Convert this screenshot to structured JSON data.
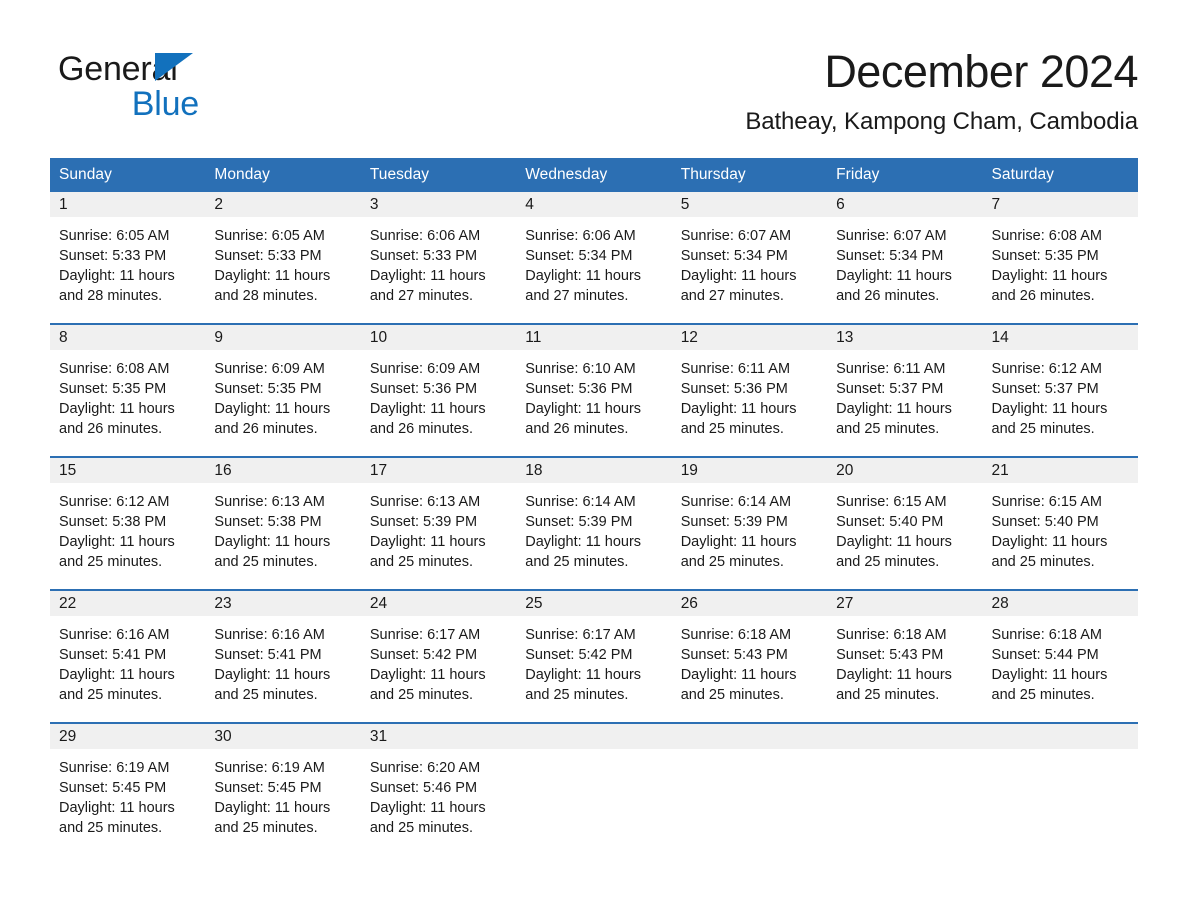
{
  "logo": {
    "word1": "General",
    "word2": "Blue",
    "triangle_color": "#1271BD",
    "word2_color": "#1271BD"
  },
  "header": {
    "month_title": "December 2024",
    "location": "Batheay, Kampong Cham, Cambodia"
  },
  "theme": {
    "header_blue": "#2C6FB3",
    "daynum_band": "#F0F0F0",
    "text": "#1a1a1a",
    "page_background": "#ffffff"
  },
  "weekday_headers": [
    "Sunday",
    "Monday",
    "Tuesday",
    "Wednesday",
    "Thursday",
    "Friday",
    "Saturday"
  ],
  "weeks": [
    [
      {
        "day": "1",
        "sunrise": "Sunrise: 6:05 AM",
        "sunset": "Sunset: 5:33 PM",
        "daylight_line1": "Daylight: 11 hours",
        "daylight_line2": "and 28 minutes."
      },
      {
        "day": "2",
        "sunrise": "Sunrise: 6:05 AM",
        "sunset": "Sunset: 5:33 PM",
        "daylight_line1": "Daylight: 11 hours",
        "daylight_line2": "and 28 minutes."
      },
      {
        "day": "3",
        "sunrise": "Sunrise: 6:06 AM",
        "sunset": "Sunset: 5:33 PM",
        "daylight_line1": "Daylight: 11 hours",
        "daylight_line2": "and 27 minutes."
      },
      {
        "day": "4",
        "sunrise": "Sunrise: 6:06 AM",
        "sunset": "Sunset: 5:34 PM",
        "daylight_line1": "Daylight: 11 hours",
        "daylight_line2": "and 27 minutes."
      },
      {
        "day": "5",
        "sunrise": "Sunrise: 6:07 AM",
        "sunset": "Sunset: 5:34 PM",
        "daylight_line1": "Daylight: 11 hours",
        "daylight_line2": "and 27 minutes."
      },
      {
        "day": "6",
        "sunrise": "Sunrise: 6:07 AM",
        "sunset": "Sunset: 5:34 PM",
        "daylight_line1": "Daylight: 11 hours",
        "daylight_line2": "and 26 minutes."
      },
      {
        "day": "7",
        "sunrise": "Sunrise: 6:08 AM",
        "sunset": "Sunset: 5:35 PM",
        "daylight_line1": "Daylight: 11 hours",
        "daylight_line2": "and 26 minutes."
      }
    ],
    [
      {
        "day": "8",
        "sunrise": "Sunrise: 6:08 AM",
        "sunset": "Sunset: 5:35 PM",
        "daylight_line1": "Daylight: 11 hours",
        "daylight_line2": "and 26 minutes."
      },
      {
        "day": "9",
        "sunrise": "Sunrise: 6:09 AM",
        "sunset": "Sunset: 5:35 PM",
        "daylight_line1": "Daylight: 11 hours",
        "daylight_line2": "and 26 minutes."
      },
      {
        "day": "10",
        "sunrise": "Sunrise: 6:09 AM",
        "sunset": "Sunset: 5:36 PM",
        "daylight_line1": "Daylight: 11 hours",
        "daylight_line2": "and 26 minutes."
      },
      {
        "day": "11",
        "sunrise": "Sunrise: 6:10 AM",
        "sunset": "Sunset: 5:36 PM",
        "daylight_line1": "Daylight: 11 hours",
        "daylight_line2": "and 26 minutes."
      },
      {
        "day": "12",
        "sunrise": "Sunrise: 6:11 AM",
        "sunset": "Sunset: 5:36 PM",
        "daylight_line1": "Daylight: 11 hours",
        "daylight_line2": "and 25 minutes."
      },
      {
        "day": "13",
        "sunrise": "Sunrise: 6:11 AM",
        "sunset": "Sunset: 5:37 PM",
        "daylight_line1": "Daylight: 11 hours",
        "daylight_line2": "and 25 minutes."
      },
      {
        "day": "14",
        "sunrise": "Sunrise: 6:12 AM",
        "sunset": "Sunset: 5:37 PM",
        "daylight_line1": "Daylight: 11 hours",
        "daylight_line2": "and 25 minutes."
      }
    ],
    [
      {
        "day": "15",
        "sunrise": "Sunrise: 6:12 AM",
        "sunset": "Sunset: 5:38 PM",
        "daylight_line1": "Daylight: 11 hours",
        "daylight_line2": "and 25 minutes."
      },
      {
        "day": "16",
        "sunrise": "Sunrise: 6:13 AM",
        "sunset": "Sunset: 5:38 PM",
        "daylight_line1": "Daylight: 11 hours",
        "daylight_line2": "and 25 minutes."
      },
      {
        "day": "17",
        "sunrise": "Sunrise: 6:13 AM",
        "sunset": "Sunset: 5:39 PM",
        "daylight_line1": "Daylight: 11 hours",
        "daylight_line2": "and 25 minutes."
      },
      {
        "day": "18",
        "sunrise": "Sunrise: 6:14 AM",
        "sunset": "Sunset: 5:39 PM",
        "daylight_line1": "Daylight: 11 hours",
        "daylight_line2": "and 25 minutes."
      },
      {
        "day": "19",
        "sunrise": "Sunrise: 6:14 AM",
        "sunset": "Sunset: 5:39 PM",
        "daylight_line1": "Daylight: 11 hours",
        "daylight_line2": "and 25 minutes."
      },
      {
        "day": "20",
        "sunrise": "Sunrise: 6:15 AM",
        "sunset": "Sunset: 5:40 PM",
        "daylight_line1": "Daylight: 11 hours",
        "daylight_line2": "and 25 minutes."
      },
      {
        "day": "21",
        "sunrise": "Sunrise: 6:15 AM",
        "sunset": "Sunset: 5:40 PM",
        "daylight_line1": "Daylight: 11 hours",
        "daylight_line2": "and 25 minutes."
      }
    ],
    [
      {
        "day": "22",
        "sunrise": "Sunrise: 6:16 AM",
        "sunset": "Sunset: 5:41 PM",
        "daylight_line1": "Daylight: 11 hours",
        "daylight_line2": "and 25 minutes."
      },
      {
        "day": "23",
        "sunrise": "Sunrise: 6:16 AM",
        "sunset": "Sunset: 5:41 PM",
        "daylight_line1": "Daylight: 11 hours",
        "daylight_line2": "and 25 minutes."
      },
      {
        "day": "24",
        "sunrise": "Sunrise: 6:17 AM",
        "sunset": "Sunset: 5:42 PM",
        "daylight_line1": "Daylight: 11 hours",
        "daylight_line2": "and 25 minutes."
      },
      {
        "day": "25",
        "sunrise": "Sunrise: 6:17 AM",
        "sunset": "Sunset: 5:42 PM",
        "daylight_line1": "Daylight: 11 hours",
        "daylight_line2": "and 25 minutes."
      },
      {
        "day": "26",
        "sunrise": "Sunrise: 6:18 AM",
        "sunset": "Sunset: 5:43 PM",
        "daylight_line1": "Daylight: 11 hours",
        "daylight_line2": "and 25 minutes."
      },
      {
        "day": "27",
        "sunrise": "Sunrise: 6:18 AM",
        "sunset": "Sunset: 5:43 PM",
        "daylight_line1": "Daylight: 11 hours",
        "daylight_line2": "and 25 minutes."
      },
      {
        "day": "28",
        "sunrise": "Sunrise: 6:18 AM",
        "sunset": "Sunset: 5:44 PM",
        "daylight_line1": "Daylight: 11 hours",
        "daylight_line2": "and 25 minutes."
      }
    ],
    [
      {
        "day": "29",
        "sunrise": "Sunrise: 6:19 AM",
        "sunset": "Sunset: 5:45 PM",
        "daylight_line1": "Daylight: 11 hours",
        "daylight_line2": "and 25 minutes."
      },
      {
        "day": "30",
        "sunrise": "Sunrise: 6:19 AM",
        "sunset": "Sunset: 5:45 PM",
        "daylight_line1": "Daylight: 11 hours",
        "daylight_line2": "and 25 minutes."
      },
      {
        "day": "31",
        "sunrise": "Sunrise: 6:20 AM",
        "sunset": "Sunset: 5:46 PM",
        "daylight_line1": "Daylight: 11 hours",
        "daylight_line2": "and 25 minutes."
      },
      {
        "day": "",
        "sunrise": "",
        "sunset": "",
        "daylight_line1": "",
        "daylight_line2": ""
      },
      {
        "day": "",
        "sunrise": "",
        "sunset": "",
        "daylight_line1": "",
        "daylight_line2": ""
      },
      {
        "day": "",
        "sunrise": "",
        "sunset": "",
        "daylight_line1": "",
        "daylight_line2": ""
      },
      {
        "day": "",
        "sunrise": "",
        "sunset": "",
        "daylight_line1": "",
        "daylight_line2": ""
      }
    ]
  ]
}
